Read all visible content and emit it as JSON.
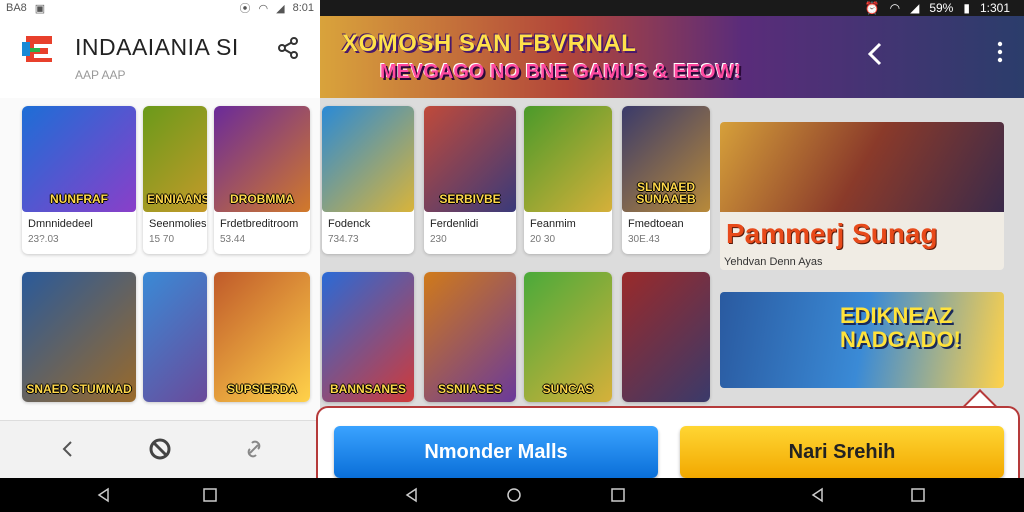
{
  "left_status": {
    "carrier": "BA8",
    "time": "8:01"
  },
  "app": {
    "title": "INDAAIANIA SI",
    "subtitle": "AAP AAP"
  },
  "grid_row1": [
    {
      "thumb_text": "NUNFRAF",
      "name": "Dmnnidedeel",
      "meta": "23?.03",
      "colors": [
        "#1d6ed6",
        "#8a3fc9"
      ]
    },
    {
      "thumb_text": "ENNIAANS",
      "name": "Seenmolies",
      "meta": "15 70",
      "colors": [
        "#6a9a1a",
        "#c49a2a"
      ]
    },
    {
      "thumb_text": "DROBMMA",
      "name": "Frdetbreditroom",
      "meta": "53.44",
      "colors": [
        "#6a2a9a",
        "#d27a2a"
      ]
    },
    {
      "thumb_text": "",
      "name": "Fodenck",
      "meta": "734.73",
      "colors": [
        "#2a8ad6",
        "#d9b43a"
      ]
    },
    {
      "thumb_text": "SERBIVBE",
      "name": "Ferdenlidi",
      "meta": "230",
      "colors": [
        "#c04a3a",
        "#3a3a7a"
      ]
    },
    {
      "thumb_text": "",
      "name": "Feanmim",
      "meta": "20 30",
      "colors": [
        "#4a9a2a",
        "#d6b03a"
      ]
    },
    {
      "thumb_text": "SLNNAED SUNAAEB",
      "name": "Fmedtoean",
      "meta": "30E.43",
      "colors": [
        "#3a3a6a",
        "#b88a3a"
      ]
    }
  ],
  "grid_row2": [
    {
      "thumb_text": "SNAED STUMNAD",
      "colors": [
        "#2a5a9a",
        "#9a6a2a"
      ]
    },
    {
      "thumb_text": "",
      "colors": [
        "#3a8ad6",
        "#6a4a9a"
      ]
    },
    {
      "thumb_text": "SUPSIERDA",
      "colors": [
        "#c05a2a",
        "#ffd24a"
      ]
    },
    {
      "thumb_text": "BANNSANES",
      "colors": [
        "#2a6ad6",
        "#d03a3a"
      ]
    },
    {
      "thumb_text": "SSNIIASES",
      "colors": [
        "#d07a1a",
        "#6a3a9a"
      ]
    },
    {
      "thumb_text": "SUNCAS",
      "colors": [
        "#4aaa3a",
        "#d6b03a"
      ]
    },
    {
      "thumb_text": "",
      "colors": [
        "#9a2a2a",
        "#3a3a6a"
      ]
    }
  ],
  "promo1": {
    "title": "Pammerj Sunag",
    "subtitle": "Yehdvan Denn Ayas"
  },
  "promo2": {
    "title": "EDIKNEAZ NADGADO!"
  },
  "right_status": {
    "battery": "59%",
    "time": "1:301"
  },
  "banner": {
    "title": "XOMOSH SAN FBVRNAL",
    "subtitle": "MEVGAGO NO BNE GAMUS & EEOW!"
  },
  "cta": {
    "primary": "Nmonder Malls",
    "secondary": "Nari Srehih"
  },
  "colors": {
    "accent_blue": "#0a6fd8",
    "accent_yellow": "#f2a800",
    "cta_border": "#b53a3a"
  }
}
